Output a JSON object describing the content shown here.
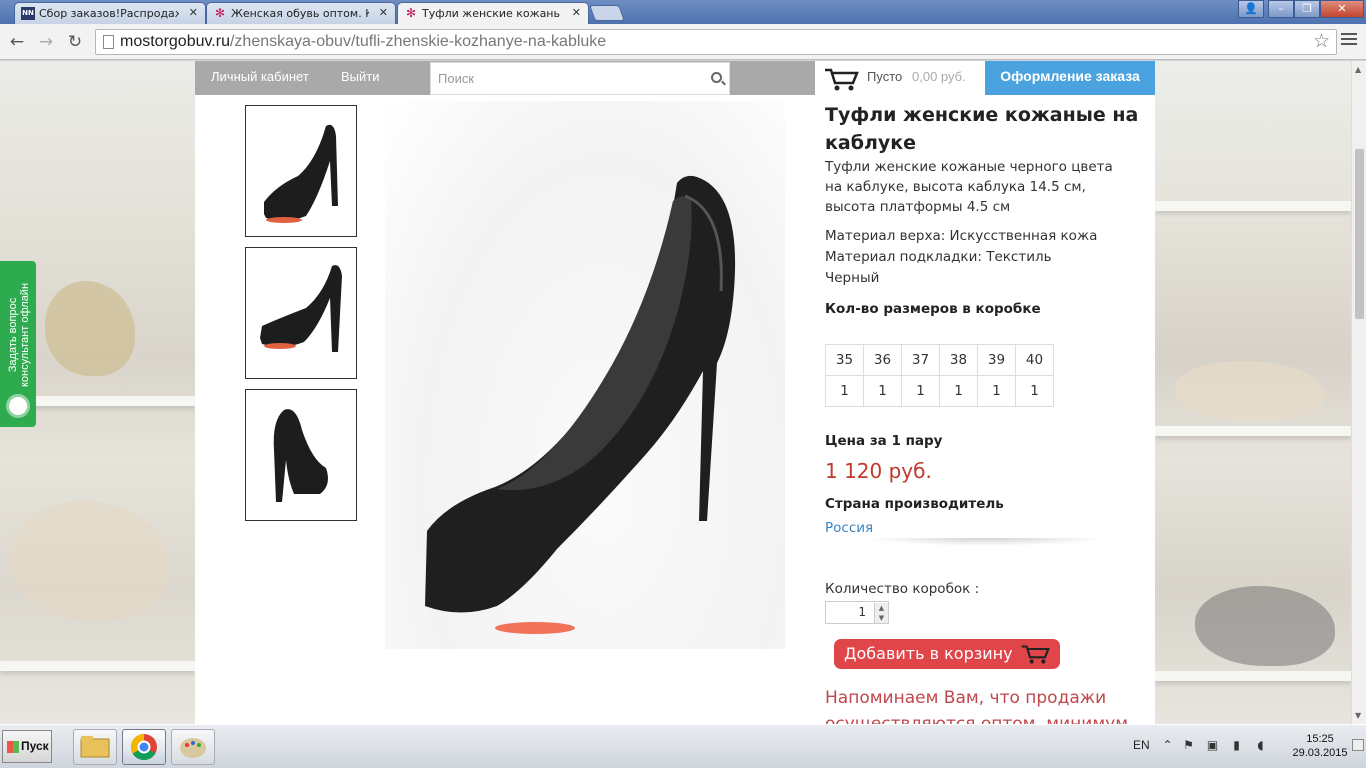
{
  "browser": {
    "tabs": [
      {
        "label": "Сбор заказов!Распродажа д",
        "favicon": "nn-logo"
      },
      {
        "label": "Женская обувь оптом. Купи",
        "favicon": "star-logo"
      },
      {
        "label": "Туфли женские кожаные н",
        "favicon": "star-logo",
        "active": true
      }
    ],
    "url_domain": "mostorgobuv.ru",
    "url_path": "/zhenskaya-obuv/tufli-zhenskie-kozhanye-na-kabluke"
  },
  "nav": {
    "account_label": "Личный кабинет",
    "logout_label": "Выйти",
    "search_placeholder": "Поиск",
    "cart_status": "Пусто",
    "cart_sum": "0,00 руб.",
    "checkout_label": "Оформление заказа"
  },
  "consultant": {
    "label_line1": "Задать вопрос",
    "label_line2": "консультант офлайн"
  },
  "product": {
    "title": "Туфли женские кожаные на каблуке",
    "description": "Туфли женские кожаные черного цвета на каблуке, высота каблука 14.5 см, высота платформы 4.5 см",
    "material_top": "Материал верха: Искусственная кожа",
    "material_lining": "Материал подкладки: Текстиль",
    "color": "Черный",
    "sizes_label": "Кол-во размеров в коробке",
    "sizes": [
      "35",
      "36",
      "37",
      "38",
      "39",
      "40"
    ],
    "size_counts": [
      "1",
      "1",
      "1",
      "1",
      "1",
      "1"
    ],
    "price_label": "Цена за 1 пару",
    "price": "1 120 руб.",
    "country_label": "Страна производитель",
    "country": "Россия",
    "quantity_label": "Количество коробок :",
    "quantity": "1",
    "add_to_cart_label": "Добавить в корзину",
    "reminder": "Напоминаем Вам, что продажи осуществляются оптом, минимум"
  },
  "colors": {
    "accent_blue": "#4aa3df",
    "price_red": "#c0392b",
    "cart_button": "#e0454a",
    "consultant_green": "#2eab4e"
  },
  "taskbar": {
    "start_label": "Пуск",
    "apps": [
      "file-explorer-icon",
      "chrome-icon",
      "paint-icon"
    ],
    "language": "EN",
    "time": "15:25",
    "date": "29.03.2015"
  }
}
